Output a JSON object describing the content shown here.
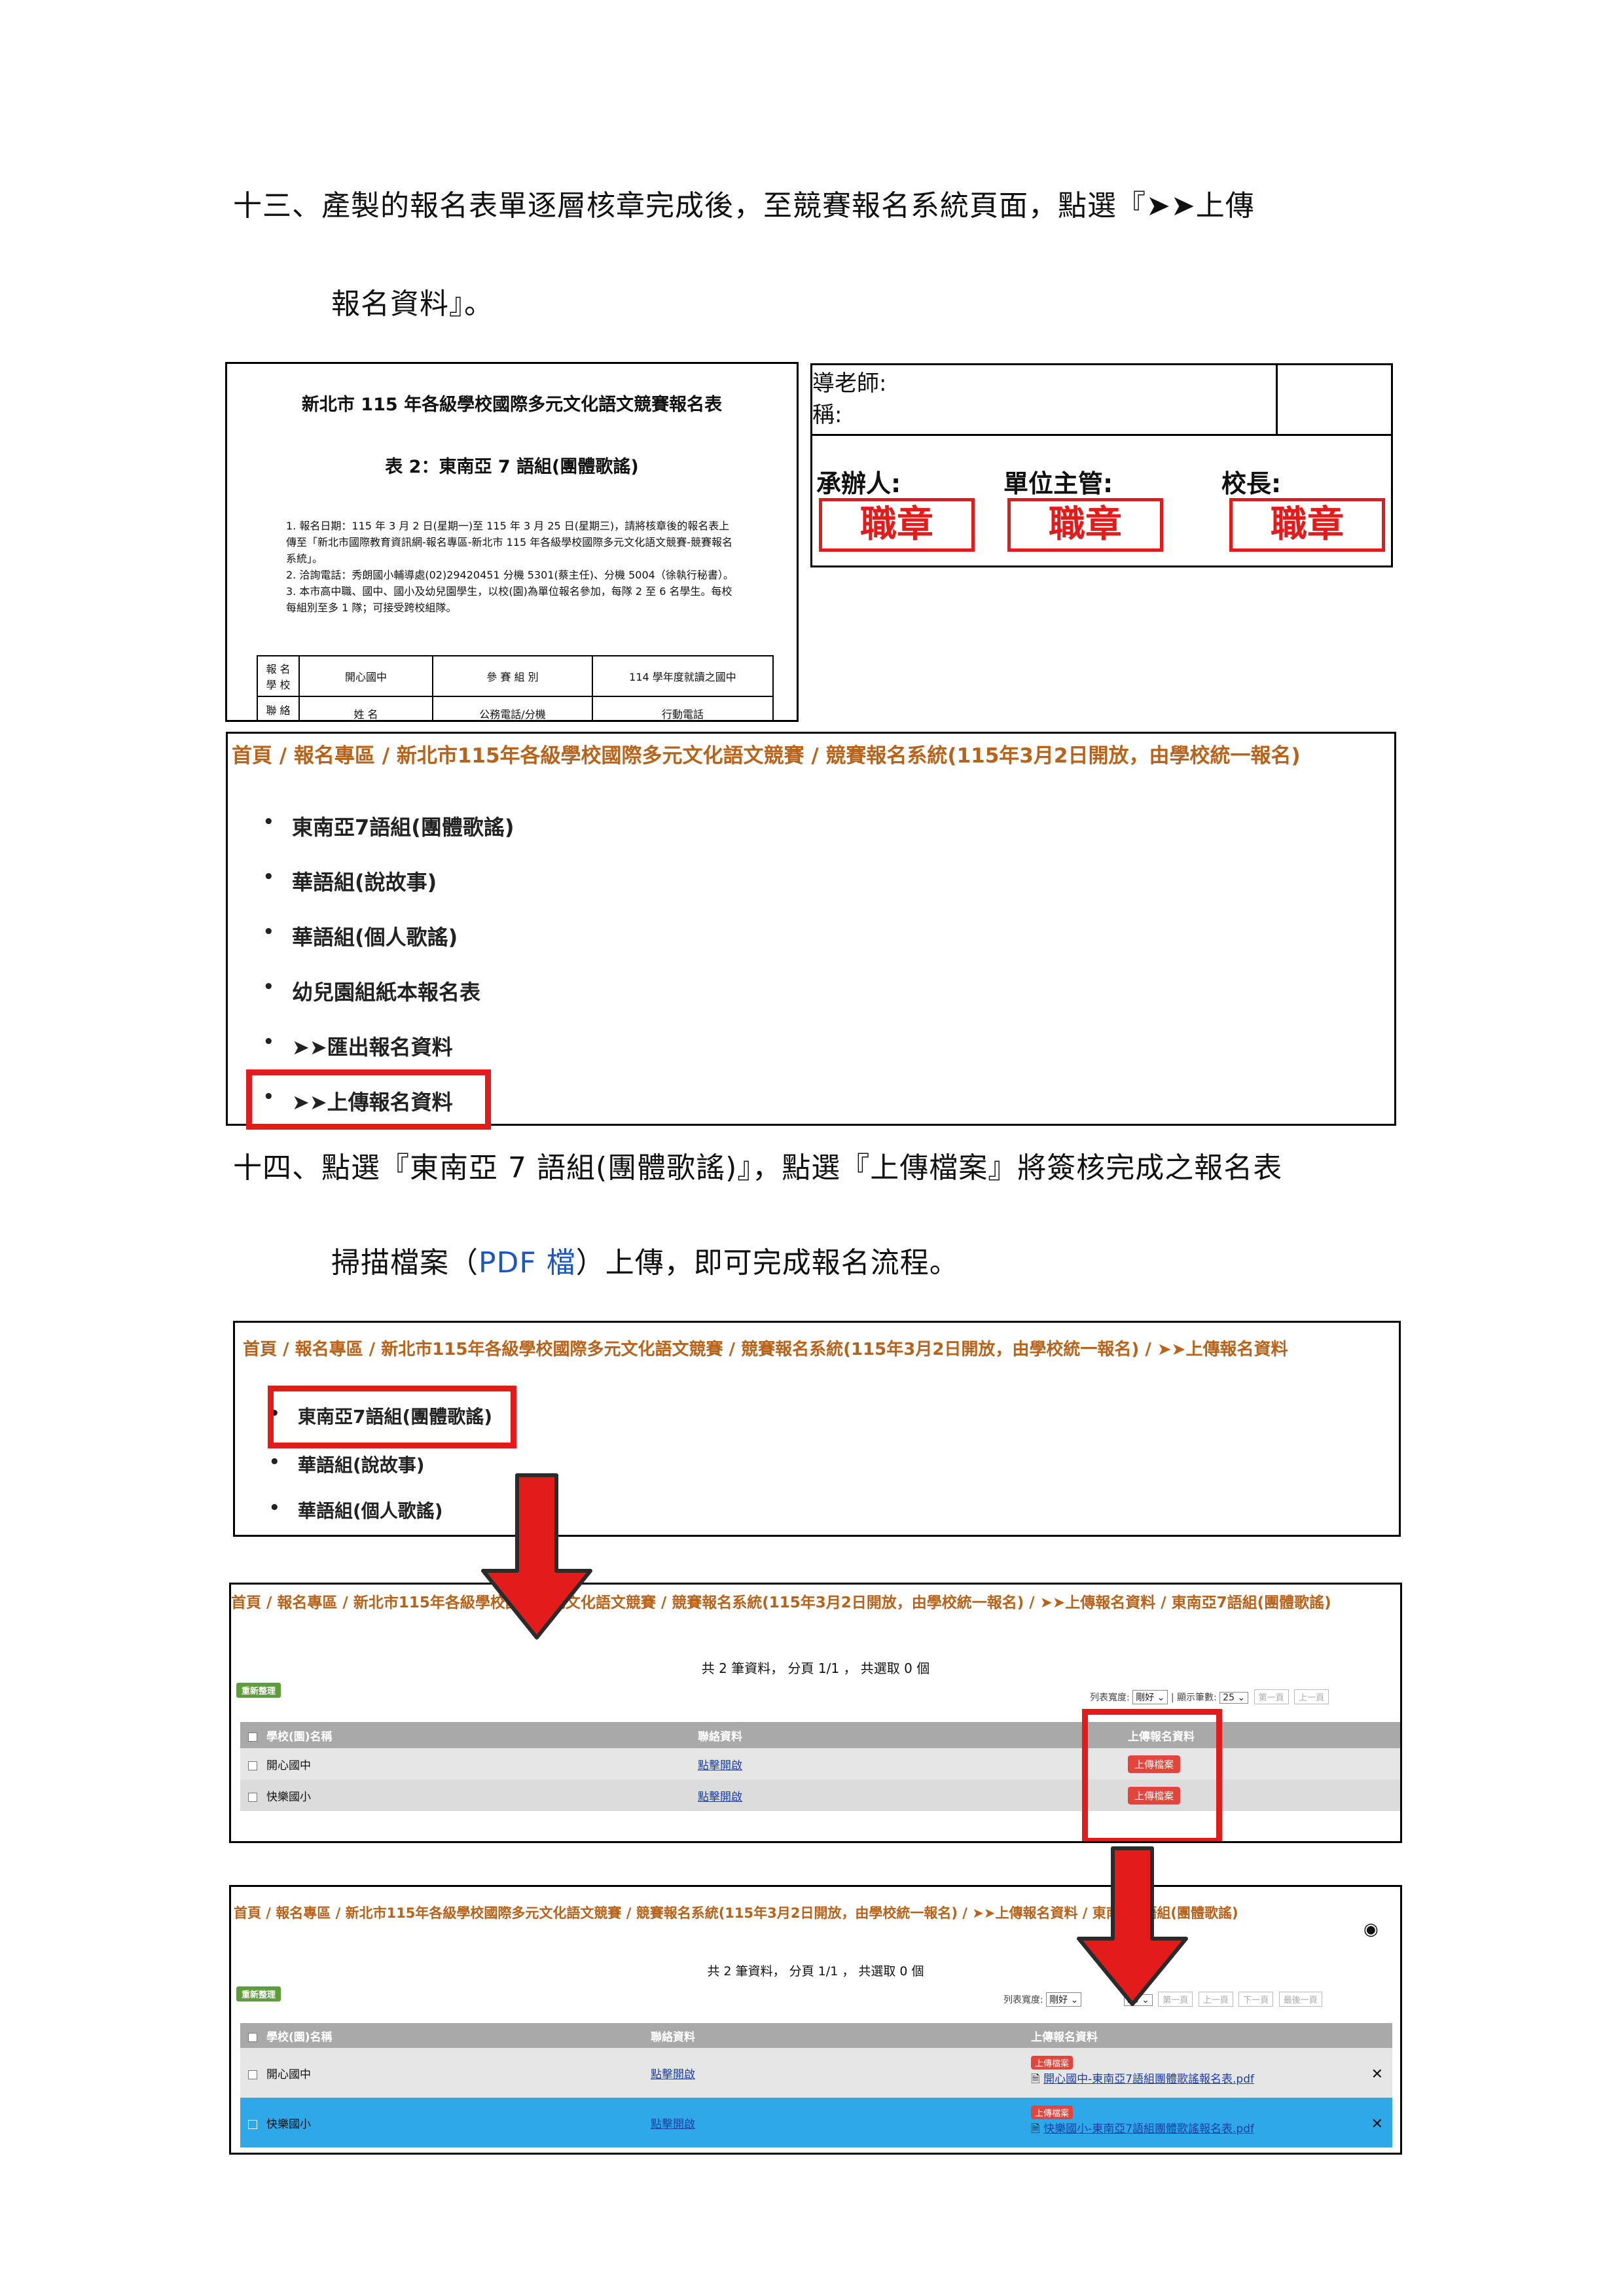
{
  "sec13": {
    "line1": "十三、產製的報名表單逐層核章完成後，至競賽報名系統頁面，點選『➤➤上傳",
    "line2": "報名資料』。"
  },
  "form": {
    "title": "新北市 115 年各級學校國際多元文化語文競賽報名表",
    "subtitle": "表 2：東南亞 7 語組(團體歌謠)",
    "notes": [
      "1. 報名日期：115 年 3 月 2 日(星期一)至 115 年 3 月 25 日(星期三)，請將核章後的報名表上傳至「新北市國際教育資訊網-報名專區-新北市 115 年各級學校國際多元文化語文競賽-競賽報名系統」。",
      "2. 洽詢電話：秀朗國小輔導處(02)29420451 分機 5301(蔡主任)、分機 5004（徐執行秘書）。",
      "3. 本市高中職、國中、國小及幼兒園學生，以校(園)為單位報名參加，每隊 2 至 6 名學生。每校每組別至多 1 隊；可接受跨校組隊。"
    ],
    "row_label": "報 名\n學 校",
    "school": "開心國中",
    "group_label": "參 賽 組 別",
    "grade_label": "114 學年度就讀之國中",
    "contact_label": "聯 絡",
    "cut1": "姓 名",
    "cut2": "公務電話/分機",
    "cut3": "行動電話"
  },
  "sign": {
    "teacher": "導老師:",
    "name": "稱:",
    "handler": "承辦人:",
    "supervisor": "單位主管:",
    "principal": "校長:",
    "stamp": "職章"
  },
  "menu1": {
    "breadcrumb": "首頁 / 報名專區 / 新北市115年各級學校國際多元文化語文競賽 / 競賽報名系統(115年3月2日開放，由學校統一報名)",
    "items": [
      "東南亞7語組(團體歌謠)",
      "華語組(說故事)",
      "華語組(個人歌謠)",
      "幼兒園組紙本報名表",
      "➤➤匯出報名資料",
      "➤➤上傳報名資料"
    ]
  },
  "sec14": {
    "line1": "十四、點選『東南亞 7 語組(團體歌謠)』，點選『上傳檔案』將簽核完成之報名表",
    "line2a": "掃描檔案（",
    "line2b": "PDF 檔",
    "line2c": "）上傳，即可完成報名流程。"
  },
  "menu2": {
    "breadcrumb": "首頁 / 報名專區 / 新北市115年各級學校國際多元文化語文競賽 / 競賽報名系統(115年3月2日開放，由學校統一報名) / ➤➤上傳報名資料",
    "items": [
      "東南亞7語組(團體歌謠)",
      "華語組(說故事)",
      "華語組(個人歌謠)"
    ]
  },
  "table1": {
    "breadcrumb": "首頁 / 報名專區 / 新北市115年各級學校國際多元文化語文競賽 / 競賽報名系統(115年3月2日開放，由學校統一報名) / ➤➤上傳報名資料 / 東南亞7語組(團體歌謠)",
    "summary": "共 2 筆資料， 分頁 1/1 ， 共選取 0 個",
    "refresh": "重新整理",
    "width_label": "列表寬度:",
    "width_value": "剛好",
    "count_label": "| 顯示筆數:",
    "count_value": "25",
    "first": "第一頁",
    "prev": "上一頁",
    "headers": [
      "學校(園)名稱",
      "聯絡資料",
      "上傳報名資料"
    ],
    "rows": [
      {
        "school": "開心國中",
        "contact": "點擊開啟",
        "upload": "上傳檔案"
      },
      {
        "school": "快樂國小",
        "contact": "點擊開啟",
        "upload": "上傳檔案"
      }
    ]
  },
  "table2": {
    "breadcrumb": "首頁 / 報名專區 / 新北市115年各級學校國際多元文化語文競賽 / 競賽報名系統(115年3月2日開放，由學校統一報名) / ➤➤上傳報名資料 / 東南亞7語組(團體歌謠)",
    "summary": "共 2 筆資料， 分頁 1/1 ， 共選取 0 個",
    "refresh": "重新整理",
    "width_label": "列表寬度:",
    "width_value": "剛好",
    "count_value": "25",
    "first": "第一頁",
    "prev": "上一頁",
    "next": "下一頁",
    "last": "最後一頁",
    "headers": [
      "學校(園)名稱",
      "聯絡資料",
      "上傳報名資料"
    ],
    "rows": [
      {
        "school": "開心國中",
        "contact": "點擊開啟",
        "upload": "上傳檔案",
        "file": "開心國中-東南亞7語組團體歌謠報名表.pdf",
        "remove": "✕"
      },
      {
        "school": "快樂國小",
        "contact": "點擊開啟",
        "upload": "上傳檔案",
        "file": "快樂國小-東南亞7語組團體歌謠報名表.pdf",
        "remove": "✕"
      }
    ]
  },
  "colors": {
    "accent": "#e31b1b",
    "breadcrumb": "#b8621a",
    "selected": "#2fa8ea",
    "link": "#1a3fa6"
  }
}
